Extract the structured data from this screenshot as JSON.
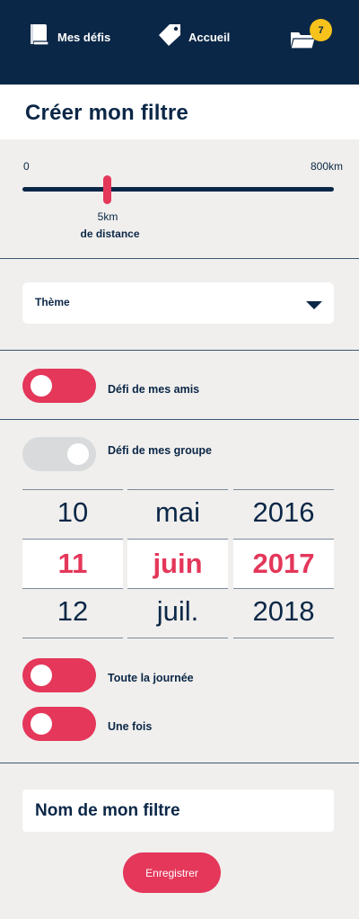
{
  "header": {
    "nav": [
      {
        "label": "Mes défis",
        "icon": "book-icon"
      },
      {
        "label": "Accueil",
        "icon": "tag-icon"
      }
    ],
    "notifications": {
      "icon": "folder-icon",
      "count": "7"
    }
  },
  "page_title": "Créer mon filtre",
  "distance": {
    "min_label": "0",
    "max_label": "800km",
    "value": "5km",
    "value_caption": "de distance",
    "fraction": 0.27
  },
  "theme_select": {
    "label": "Thème"
  },
  "toggles": {
    "amis": {
      "label": "Défi de mes amis",
      "on": true
    },
    "groupe": {
      "label": "Défi de mes groupe",
      "on": false
    },
    "journee": {
      "label": "Toute la journée",
      "on": true
    },
    "une_fois": {
      "label": "Une fois",
      "on": true
    }
  },
  "date_picker": {
    "days": [
      "10",
      "11",
      "12"
    ],
    "months": [
      "mai",
      "juin",
      "juil."
    ],
    "years": [
      "2016",
      "2017",
      "2018"
    ],
    "selected": {
      "day": "11",
      "month": "juin",
      "year": "2017"
    }
  },
  "filter_name": {
    "placeholder": "Nom de mon filtre"
  },
  "save_button": "Enregistrer",
  "colors": {
    "navy": "#0b2747",
    "accent": "#e4375a",
    "badge": "#f6c21b",
    "background": "#f0efed"
  }
}
